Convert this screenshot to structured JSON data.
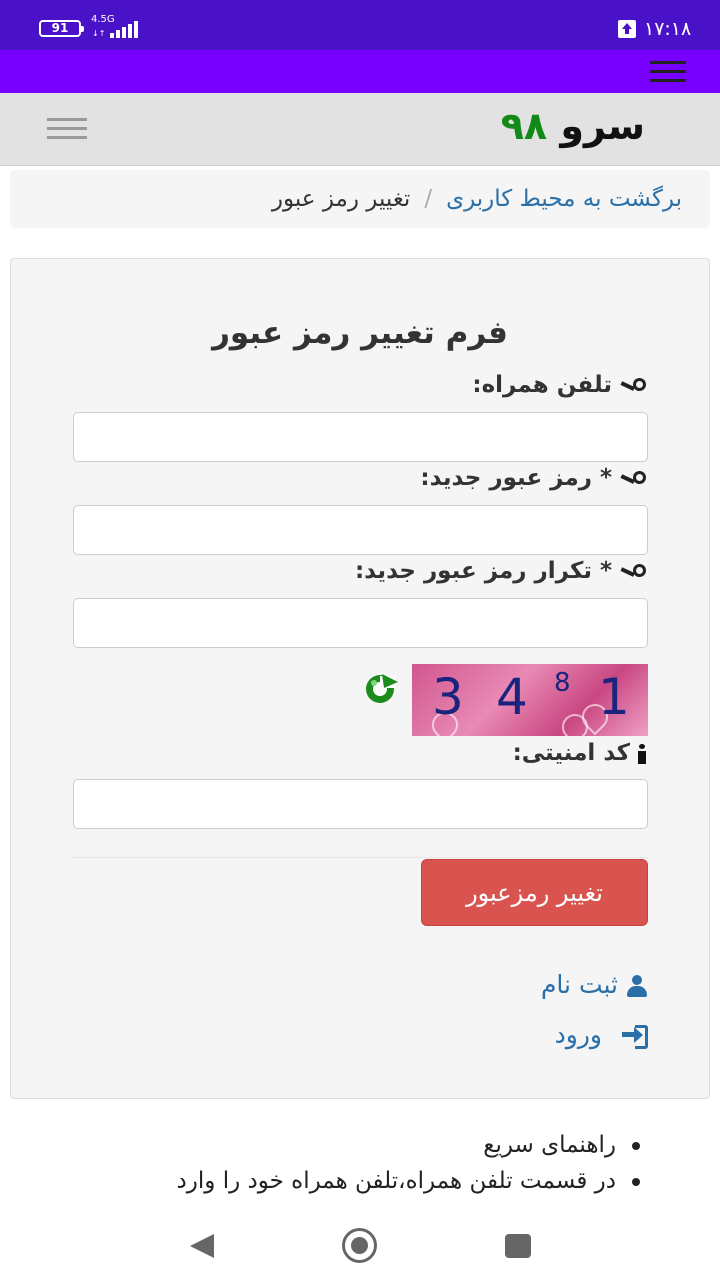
{
  "status_bar": {
    "battery": "91",
    "network": "4.5G",
    "network_arrows": "↓↑",
    "time": "۱۷:۱۸"
  },
  "header": {
    "logo_word": "سرو",
    "logo_number": "۹۸"
  },
  "breadcrumb": {
    "back_link": "برگشت به محیط کاربری",
    "separator": "/",
    "current": "تغییر رمز عبور"
  },
  "form": {
    "title": "فرم تغییر رمز عبور",
    "phone_label": "تلفن همراه:",
    "new_password_label": "* رمز عبور جدید:",
    "repeat_password_label": "* تکرار رمز عبور جدید:",
    "captcha_label": "کد امنیتی:",
    "captcha_digits": [
      "3",
      "4",
      "8",
      "1"
    ],
    "submit_label": "تغییر رمزعبور"
  },
  "links": {
    "register": "ثبت نام",
    "login": "ورود"
  },
  "guide": {
    "items": [
      "راهنمای سریع",
      "در قسمت تلفن همراه،تلفن همراه خود را وارد"
    ]
  },
  "colors": {
    "status_bar": "#4a12c8",
    "top_nav": "#7800ff",
    "logo_number": "#138a17",
    "submit": "#d9534f",
    "link": "#2a6fa8"
  },
  "icons": [
    "key-icon",
    "info-icon",
    "refresh-icon",
    "user-icon",
    "sign-in-icon",
    "hamburger-icon"
  ]
}
